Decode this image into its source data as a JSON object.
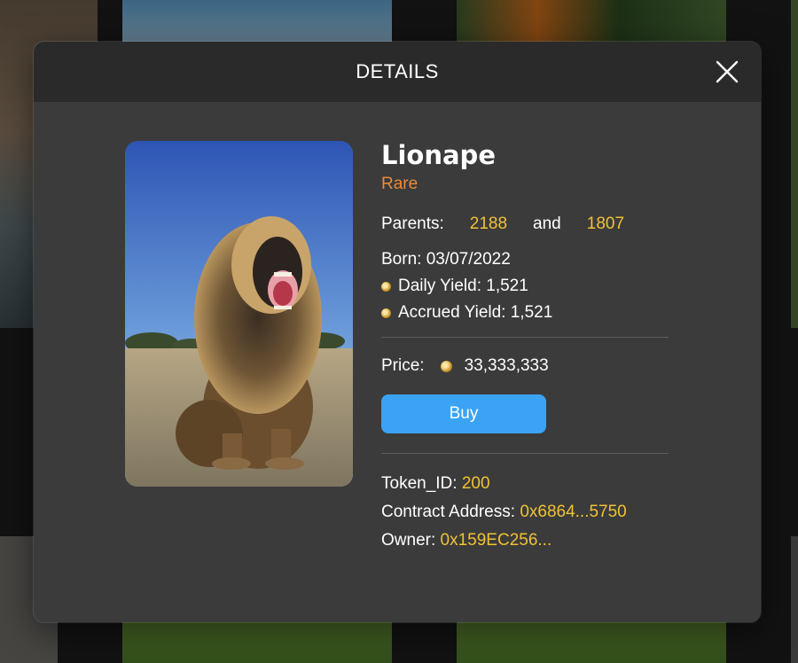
{
  "modal": {
    "title": "DETAILS",
    "close_icon": "close-icon"
  },
  "nft": {
    "name": "Lionape",
    "rarity": "Rare",
    "parents_label": "Parents:",
    "parent_1": "2188",
    "parents_and": "and",
    "parent_2": "1807",
    "born": "Born: 03/07/2022",
    "daily_yield": "Daily Yield: 1,521",
    "accrued_yield": "Accrued Yield: 1,521",
    "price_label": "Price:",
    "price_value": "33,333,333",
    "buy_label": "Buy",
    "token_id_label": "Token_ID:",
    "token_id_value": "200",
    "contract_label": "Contract Address:",
    "contract_value": "0x6864...5750",
    "owner_label": "Owner:",
    "owner_value": "0x159EC256..."
  },
  "colors": {
    "accent_gold": "#f2c234",
    "rarity_orange": "#ef8a35",
    "buy_blue": "#3aa3f4",
    "modal_bg": "#3b3b3b",
    "header_bg": "#2a2a2a"
  },
  "icons": {
    "coin": "coin-icon",
    "close": "close-icon"
  }
}
